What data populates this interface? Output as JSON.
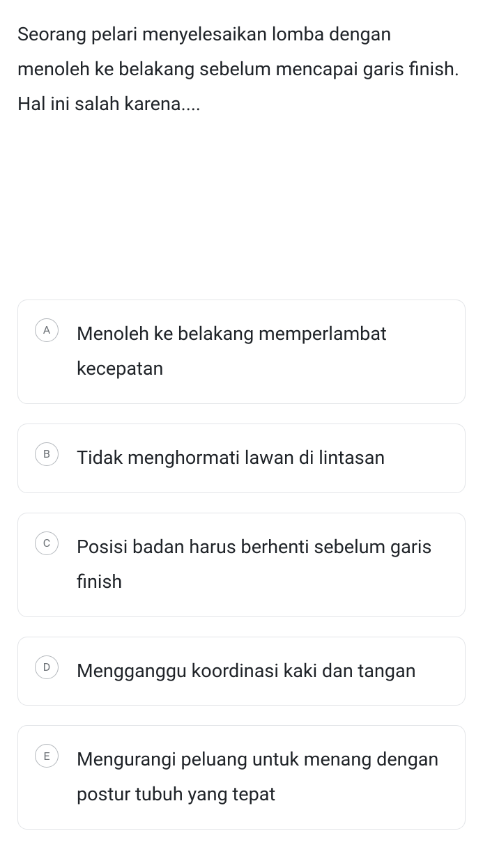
{
  "question": "Seorang pelari menyelesaikan lomba dengan menoleh ke belakang sebelum mencapai garis finish. Hal ini salah karena....",
  "options": [
    {
      "letter": "A",
      "text": "Menoleh ke belakang memperlambat kecepatan"
    },
    {
      "letter": "B",
      "text": "Tidak menghormati lawan di lintasan"
    },
    {
      "letter": "C",
      "text": "Posisi badan harus berhenti sebelum garis finish"
    },
    {
      "letter": "D",
      "text": "Mengganggu koordinasi kaki dan tangan"
    },
    {
      "letter": "E",
      "text": "Mengurangi peluang untuk menang dengan postur tubuh yang tepat"
    }
  ]
}
